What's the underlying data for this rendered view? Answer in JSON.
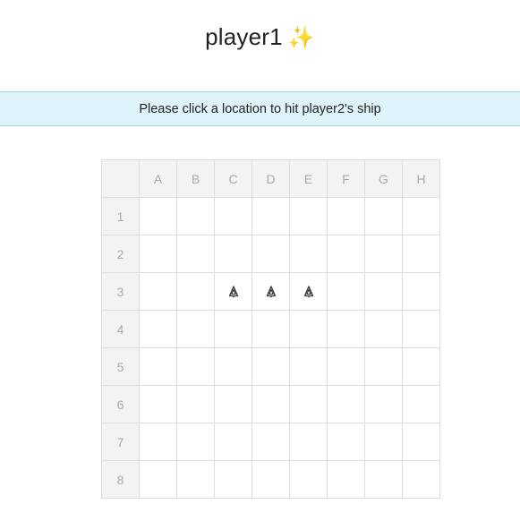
{
  "title": {
    "player": "player1",
    "emoji": "✨"
  },
  "banner": {
    "message": "Please click a location to hit player2's ship"
  },
  "board": {
    "corner": "",
    "columns": [
      "A",
      "B",
      "C",
      "D",
      "E",
      "F",
      "G",
      "H"
    ],
    "rows": [
      "1",
      "2",
      "3",
      "4",
      "5",
      "6",
      "7",
      "8"
    ],
    "ship_icon": "ship-icon",
    "ship_cells": [
      {
        "row": "3",
        "col": "C"
      },
      {
        "row": "3",
        "col": "D"
      },
      {
        "row": "3",
        "col": "E"
      }
    ]
  }
}
